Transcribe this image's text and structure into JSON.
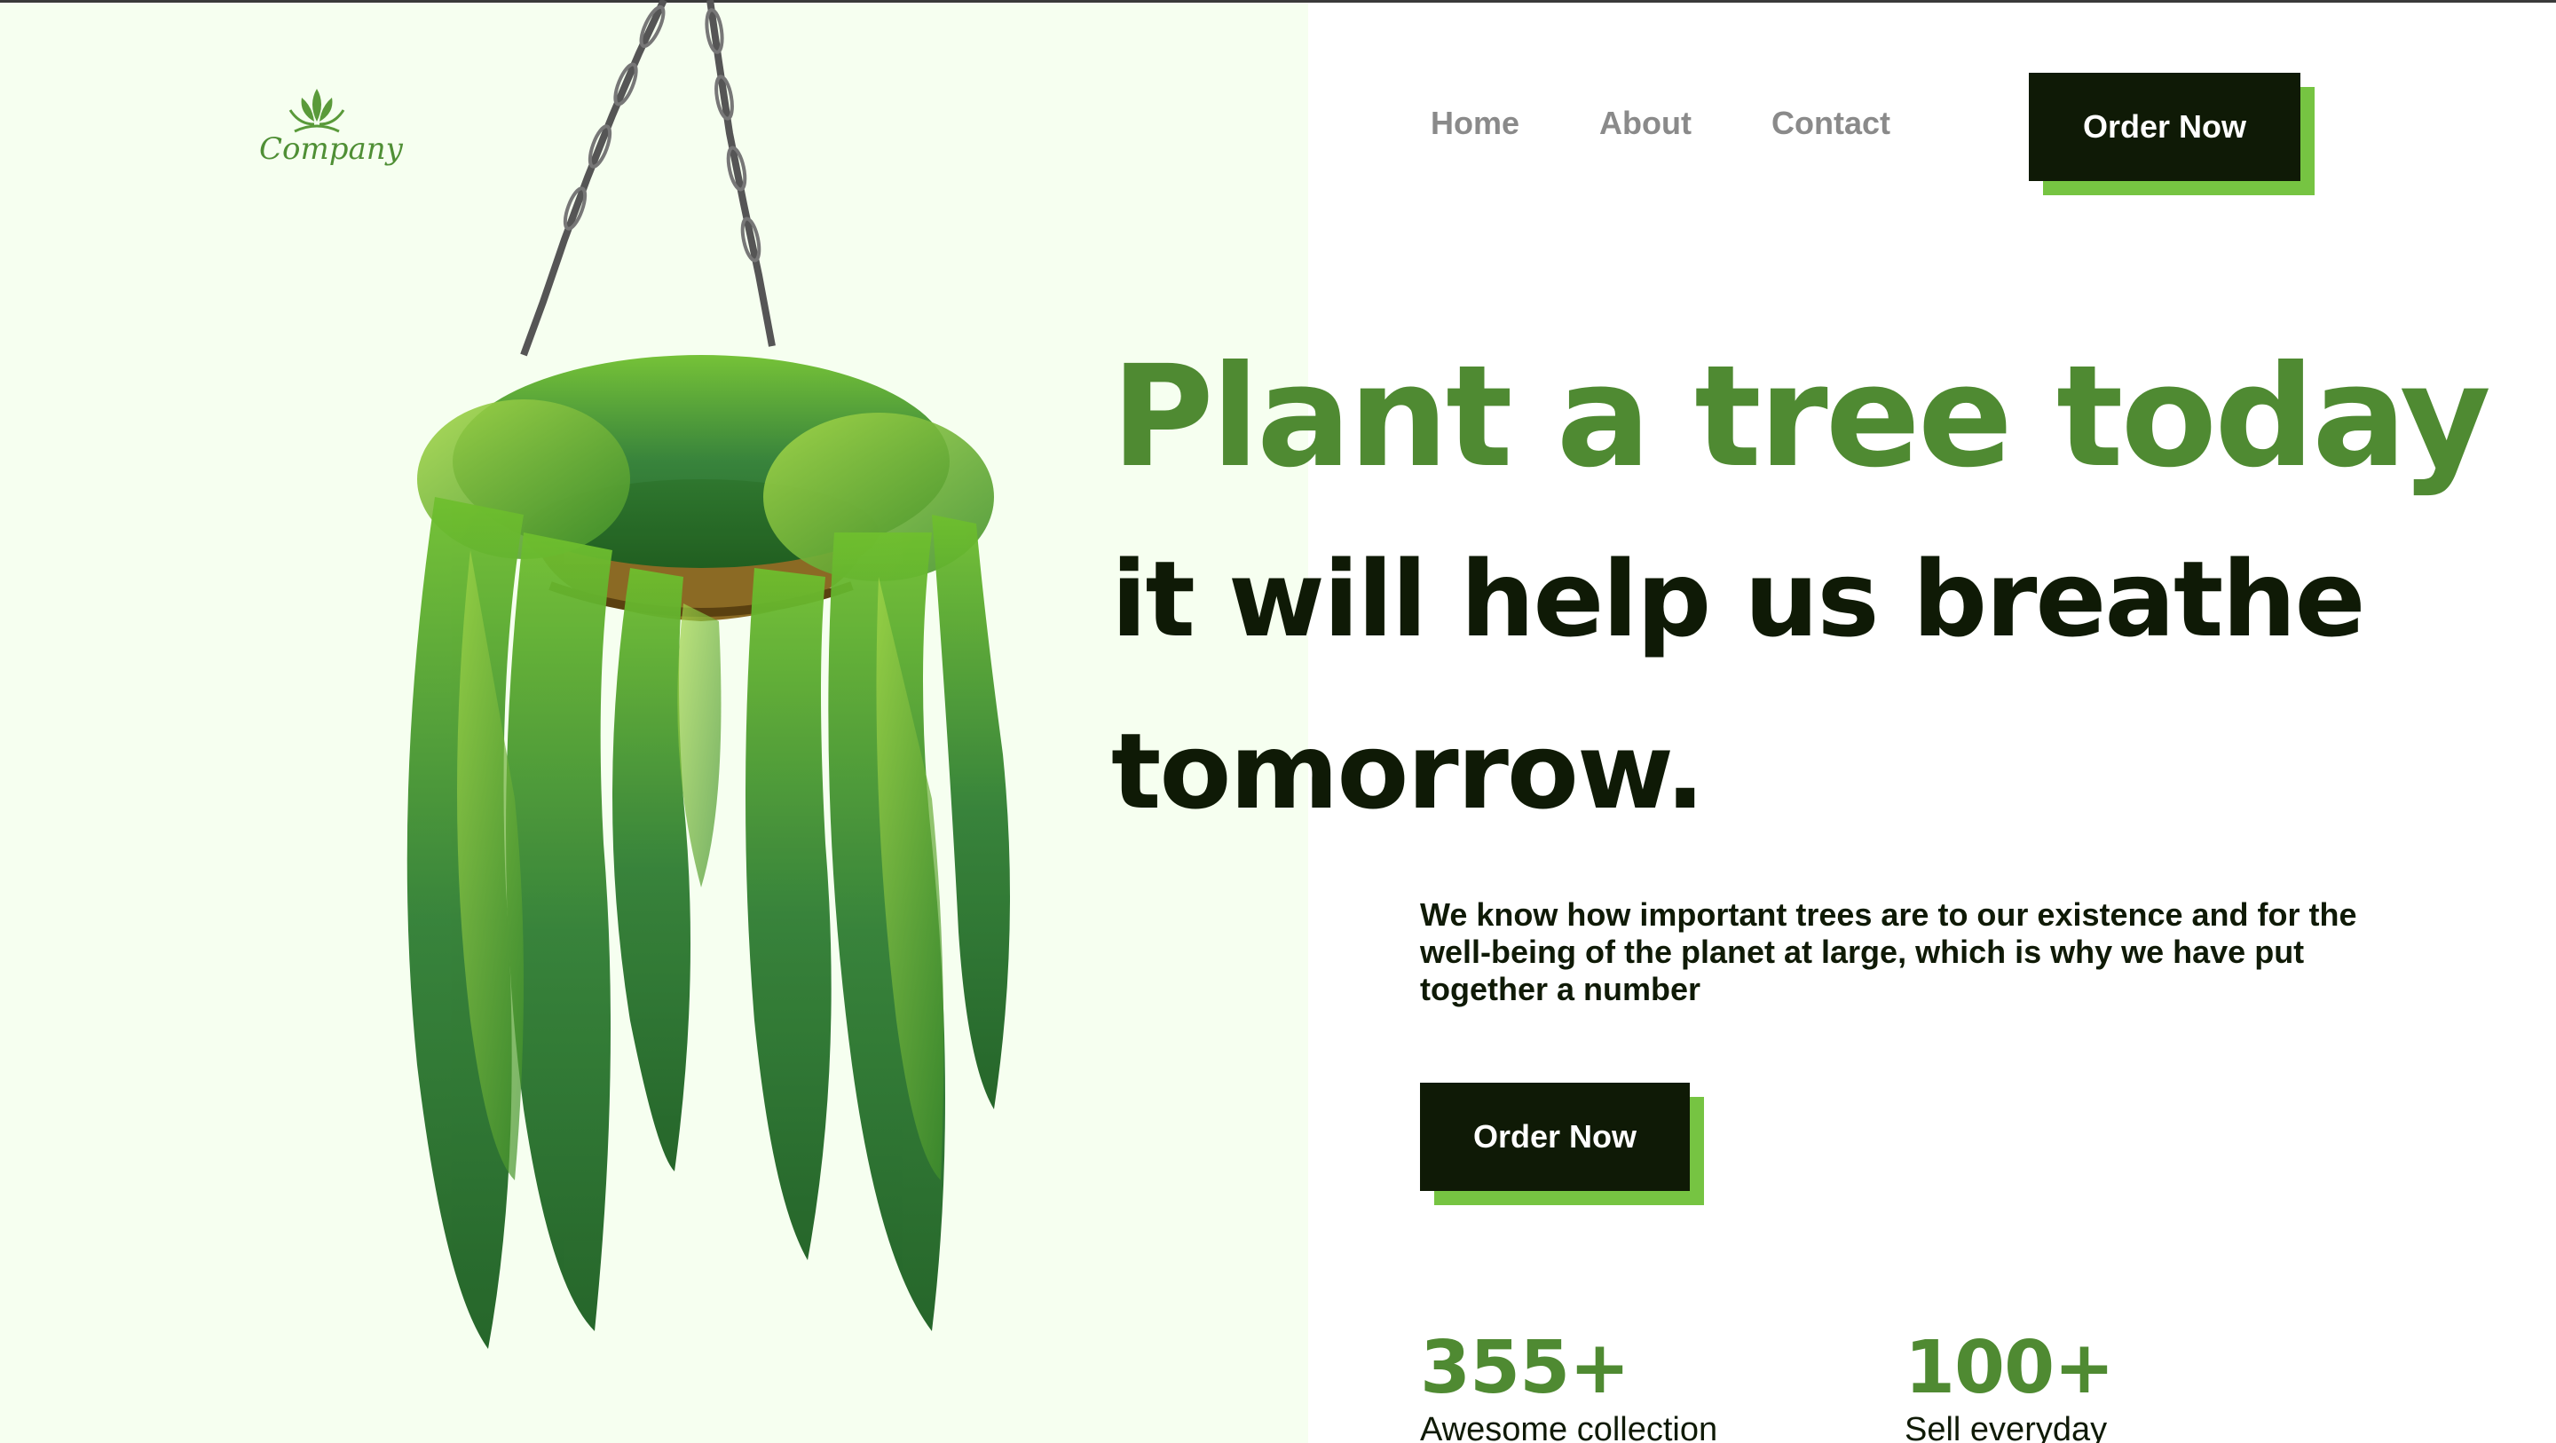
{
  "header": {
    "logo_text": "Company",
    "nav": [
      "Home",
      "About",
      "Contact"
    ],
    "cta_label": "Order Now"
  },
  "hero": {
    "headline": "Plant a tree today",
    "subline1": "it will help us breathe",
    "subline2": "tomorrow.",
    "description": "We know how important trees are to our existence and for the well-being of the planet at large, which is why we have put together a number",
    "cta_label": "Order Now"
  },
  "stats": [
    {
      "value": "355+",
      "label": "Awesome collection"
    },
    {
      "value": "100+",
      "label": "Sell everyday"
    }
  ],
  "colors": {
    "accent_green": "#4f8a32",
    "shadow_green": "#76c442",
    "dark": "#0f1a06",
    "left_bg": "#f6fff0"
  }
}
